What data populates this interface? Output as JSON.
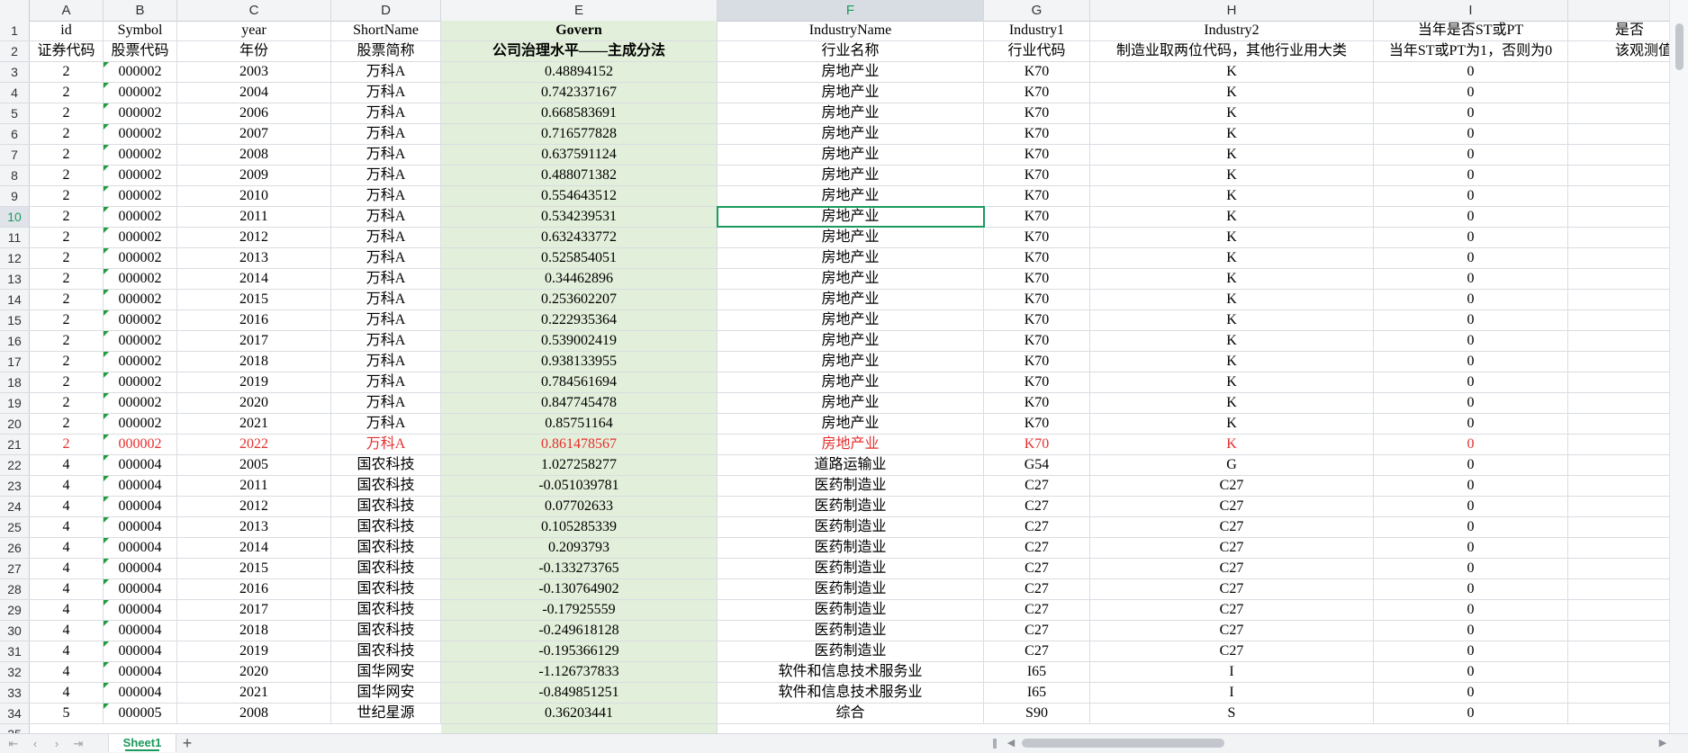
{
  "columns": [
    "A",
    "B",
    "C",
    "D",
    "E",
    "F",
    "G",
    "H",
    "I"
  ],
  "selected_column": "F",
  "selected_row": "10",
  "header_row_1": [
    "id",
    "Symbol",
    "year",
    "ShortName",
    "Govern",
    "IndustryName",
    "Industry1",
    "Industry2",
    "当年是否ST或PT",
    "是否"
  ],
  "header_row_2": [
    "证券代码",
    "股票代码",
    "年份",
    "股票简称",
    "公司治理水平——主成分法",
    "行业名称",
    "行业代码",
    "制造业取两位代码，其他行业用大类",
    "当年ST或PT为1，否则为0",
    "该观测值属于"
  ],
  "data_rows": [
    {
      "n": "3",
      "id": "2",
      "symbol": "000002",
      "year": "2003",
      "name": "万科A",
      "govern": "0.48894152",
      "industry": "房地产业",
      "ind1": "K70",
      "ind2": "K",
      "st": "0"
    },
    {
      "n": "4",
      "id": "2",
      "symbol": "000002",
      "year": "2004",
      "name": "万科A",
      "govern": "0.742337167",
      "industry": "房地产业",
      "ind1": "K70",
      "ind2": "K",
      "st": "0"
    },
    {
      "n": "5",
      "id": "2",
      "symbol": "000002",
      "year": "2006",
      "name": "万科A",
      "govern": "0.668583691",
      "industry": "房地产业",
      "ind1": "K70",
      "ind2": "K",
      "st": "0"
    },
    {
      "n": "6",
      "id": "2",
      "symbol": "000002",
      "year": "2007",
      "name": "万科A",
      "govern": "0.716577828",
      "industry": "房地产业",
      "ind1": "K70",
      "ind2": "K",
      "st": "0"
    },
    {
      "n": "7",
      "id": "2",
      "symbol": "000002",
      "year": "2008",
      "name": "万科A",
      "govern": "0.637591124",
      "industry": "房地产业",
      "ind1": "K70",
      "ind2": "K",
      "st": "0"
    },
    {
      "n": "8",
      "id": "2",
      "symbol": "000002",
      "year": "2009",
      "name": "万科A",
      "govern": "0.488071382",
      "industry": "房地产业",
      "ind1": "K70",
      "ind2": "K",
      "st": "0"
    },
    {
      "n": "9",
      "id": "2",
      "symbol": "000002",
      "year": "2010",
      "name": "万科A",
      "govern": "0.554643512",
      "industry": "房地产业",
      "ind1": "K70",
      "ind2": "K",
      "st": "0"
    },
    {
      "n": "10",
      "id": "2",
      "symbol": "000002",
      "year": "2011",
      "name": "万科A",
      "govern": "0.534239531",
      "industry": "房地产业",
      "ind1": "K70",
      "ind2": "K",
      "st": "0"
    },
    {
      "n": "11",
      "id": "2",
      "symbol": "000002",
      "year": "2012",
      "name": "万科A",
      "govern": "0.632433772",
      "industry": "房地产业",
      "ind1": "K70",
      "ind2": "K",
      "st": "0"
    },
    {
      "n": "12",
      "id": "2",
      "symbol": "000002",
      "year": "2013",
      "name": "万科A",
      "govern": "0.525854051",
      "industry": "房地产业",
      "ind1": "K70",
      "ind2": "K",
      "st": "0"
    },
    {
      "n": "13",
      "id": "2",
      "symbol": "000002",
      "year": "2014",
      "name": "万科A",
      "govern": "0.34462896",
      "industry": "房地产业",
      "ind1": "K70",
      "ind2": "K",
      "st": "0"
    },
    {
      "n": "14",
      "id": "2",
      "symbol": "000002",
      "year": "2015",
      "name": "万科A",
      "govern": "0.253602207",
      "industry": "房地产业",
      "ind1": "K70",
      "ind2": "K",
      "st": "0"
    },
    {
      "n": "15",
      "id": "2",
      "symbol": "000002",
      "year": "2016",
      "name": "万科A",
      "govern": "0.222935364",
      "industry": "房地产业",
      "ind1": "K70",
      "ind2": "K",
      "st": "0"
    },
    {
      "n": "16",
      "id": "2",
      "symbol": "000002",
      "year": "2017",
      "name": "万科A",
      "govern": "0.539002419",
      "industry": "房地产业",
      "ind1": "K70",
      "ind2": "K",
      "st": "0"
    },
    {
      "n": "17",
      "id": "2",
      "symbol": "000002",
      "year": "2018",
      "name": "万科A",
      "govern": "0.938133955",
      "industry": "房地产业",
      "ind1": "K70",
      "ind2": "K",
      "st": "0"
    },
    {
      "n": "18",
      "id": "2",
      "symbol": "000002",
      "year": "2019",
      "name": "万科A",
      "govern": "0.784561694",
      "industry": "房地产业",
      "ind1": "K70",
      "ind2": "K",
      "st": "0"
    },
    {
      "n": "19",
      "id": "2",
      "symbol": "000002",
      "year": "2020",
      "name": "万科A",
      "govern": "0.847745478",
      "industry": "房地产业",
      "ind1": "K70",
      "ind2": "K",
      "st": "0"
    },
    {
      "n": "20",
      "id": "2",
      "symbol": "000002",
      "year": "2021",
      "name": "万科A",
      "govern": "0.85751164",
      "industry": "房地产业",
      "ind1": "K70",
      "ind2": "K",
      "st": "0"
    },
    {
      "n": "21",
      "id": "2",
      "symbol": "000002",
      "year": "2022",
      "name": "万科A",
      "govern": "0.861478567",
      "industry": "房地产业",
      "ind1": "K70",
      "ind2": "K",
      "st": "0",
      "red": true
    },
    {
      "n": "22",
      "id": "4",
      "symbol": "000004",
      "year": "2005",
      "name": "国农科技",
      "govern": "1.027258277",
      "industry": "道路运输业",
      "ind1": "G54",
      "ind2": "G",
      "st": "0"
    },
    {
      "n": "23",
      "id": "4",
      "symbol": "000004",
      "year": "2011",
      "name": "国农科技",
      "govern": "-0.051039781",
      "industry": "医药制造业",
      "ind1": "C27",
      "ind2": "C27",
      "st": "0"
    },
    {
      "n": "24",
      "id": "4",
      "symbol": "000004",
      "year": "2012",
      "name": "国农科技",
      "govern": "0.07702633",
      "industry": "医药制造业",
      "ind1": "C27",
      "ind2": "C27",
      "st": "0"
    },
    {
      "n": "25",
      "id": "4",
      "symbol": "000004",
      "year": "2013",
      "name": "国农科技",
      "govern": "0.105285339",
      "industry": "医药制造业",
      "ind1": "C27",
      "ind2": "C27",
      "st": "0"
    },
    {
      "n": "26",
      "id": "4",
      "symbol": "000004",
      "year": "2014",
      "name": "国农科技",
      "govern": "0.2093793",
      "industry": "医药制造业",
      "ind1": "C27",
      "ind2": "C27",
      "st": "0"
    },
    {
      "n": "27",
      "id": "4",
      "symbol": "000004",
      "year": "2015",
      "name": "国农科技",
      "govern": "-0.133273765",
      "industry": "医药制造业",
      "ind1": "C27",
      "ind2": "C27",
      "st": "0"
    },
    {
      "n": "28",
      "id": "4",
      "symbol": "000004",
      "year": "2016",
      "name": "国农科技",
      "govern": "-0.130764902",
      "industry": "医药制造业",
      "ind1": "C27",
      "ind2": "C27",
      "st": "0"
    },
    {
      "n": "29",
      "id": "4",
      "symbol": "000004",
      "year": "2017",
      "name": "国农科技",
      "govern": "-0.17925559",
      "industry": "医药制造业",
      "ind1": "C27",
      "ind2": "C27",
      "st": "0"
    },
    {
      "n": "30",
      "id": "4",
      "symbol": "000004",
      "year": "2018",
      "name": "国农科技",
      "govern": "-0.249618128",
      "industry": "医药制造业",
      "ind1": "C27",
      "ind2": "C27",
      "st": "0"
    },
    {
      "n": "31",
      "id": "4",
      "symbol": "000004",
      "year": "2019",
      "name": "国农科技",
      "govern": "-0.195366129",
      "industry": "医药制造业",
      "ind1": "C27",
      "ind2": "C27",
      "st": "0"
    },
    {
      "n": "32",
      "id": "4",
      "symbol": "000004",
      "year": "2020",
      "name": "国华网安",
      "govern": "-1.126737833",
      "industry": "软件和信息技术服务业",
      "ind1": "I65",
      "ind2": "I",
      "st": "0"
    },
    {
      "n": "33",
      "id": "4",
      "symbol": "000004",
      "year": "2021",
      "name": "国华网安",
      "govern": "-0.849851251",
      "industry": "软件和信息技术服务业",
      "ind1": "I65",
      "ind2": "I",
      "st": "0"
    },
    {
      "n": "34",
      "id": "5",
      "symbol": "000005",
      "year": "2008",
      "name": "世纪星源",
      "govern": "0.36203441",
      "industry": "综合",
      "ind1": "S90",
      "ind2": "S",
      "st": "0"
    }
  ],
  "bottom": {
    "sheet_tab": "Sheet1",
    "add_sheet": "+",
    "nav_first": "⇤",
    "nav_prev": "‹",
    "nav_next": "›",
    "nav_last": "⇥"
  },
  "colors": {
    "selection": "#1a9a5c",
    "highlight_column": "#e2efda",
    "red_row": "#e62e2e"
  }
}
